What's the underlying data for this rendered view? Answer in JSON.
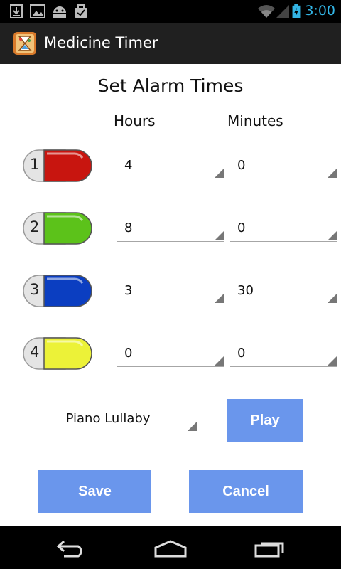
{
  "status_bar": {
    "time": "3:00",
    "left_icons": [
      "download-icon",
      "image-icon",
      "android-icon",
      "briefcase-icon"
    ],
    "right_icons": [
      "wifi-icon",
      "no-signal-icon",
      "battery-charging-icon"
    ]
  },
  "action_bar": {
    "title": "Medicine Timer",
    "icon": "hourglass-app-icon"
  },
  "main": {
    "heading": "Set Alarm Times",
    "col_hours": "Hours",
    "col_minutes": "Minutes",
    "rows": [
      {
        "number": "1",
        "color": "#c8150f",
        "hours": "4",
        "minutes": "0"
      },
      {
        "number": "2",
        "color": "#5cc21a",
        "hours": "8",
        "minutes": "0"
      },
      {
        "number": "3",
        "color": "#0b3ec1",
        "hours": "3",
        "minutes": "30"
      },
      {
        "number": "4",
        "color": "#ecf238",
        "hours": "0",
        "minutes": "0"
      }
    ],
    "sound": "Piano Lullaby",
    "play_label": "Play",
    "save_label": "Save",
    "cancel_label": "Cancel"
  },
  "colors": {
    "button": "#6a96ec",
    "accent": "#33b5e5"
  },
  "nav_bar": {
    "icons": [
      "back-icon",
      "home-icon",
      "recent-apps-icon"
    ]
  }
}
